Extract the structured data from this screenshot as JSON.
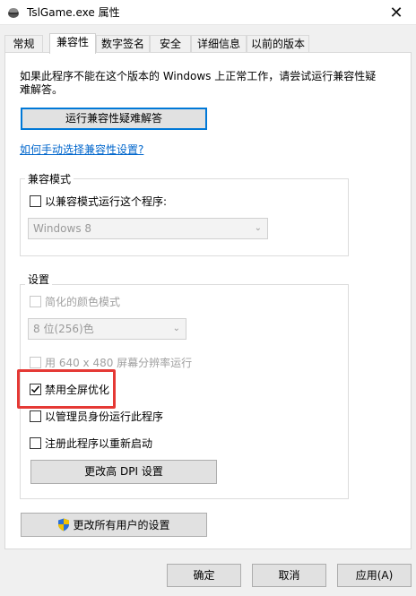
{
  "window": {
    "title": "TslGame.exe 属性",
    "close_glyph": "✕"
  },
  "tabs": [
    {
      "label": "常规"
    },
    {
      "label": "兼容性",
      "active": true
    },
    {
      "label": "数字签名"
    },
    {
      "label": "安全"
    },
    {
      "label": "详细信息"
    },
    {
      "label": "以前的版本"
    }
  ],
  "compat": {
    "intro": "如果此程序不能在这个版本的 Windows 上正常工作，请尝试运行兼容性疑难解答。",
    "troubleshoot_button": "运行兼容性疑难解答",
    "manual_link": "如何手动选择兼容性设置?"
  },
  "compat_mode": {
    "group_title": "兼容模式",
    "checkbox_label": "以兼容模式运行这个程序:",
    "checked": false,
    "os_select_value": "Windows 8"
  },
  "settings": {
    "group_title": "设置",
    "reduced_color": {
      "label": "简化的颜色模式",
      "checked": false,
      "enabled": false
    },
    "color_select_value": "8 位(256)色",
    "res_640": {
      "label": "用 640 x 480 屏幕分辨率运行",
      "checked": false,
      "enabled": false
    },
    "disable_fullscreen_opt": {
      "label": "禁用全屏优化",
      "checked": true
    },
    "run_as_admin": {
      "label": "以管理员身份运行此程序",
      "checked": false
    },
    "register_restart": {
      "label": "注册此程序以重新启动",
      "checked": false
    },
    "dpi_button": "更改高 DPI 设置"
  },
  "all_users_button": "更改所有用户的设置",
  "footer": {
    "ok": "确定",
    "cancel": "取消",
    "apply": "应用(A)"
  },
  "colors": {
    "accent": "#0078d7",
    "highlight_box": "#e53935",
    "link": "#0066cc"
  }
}
